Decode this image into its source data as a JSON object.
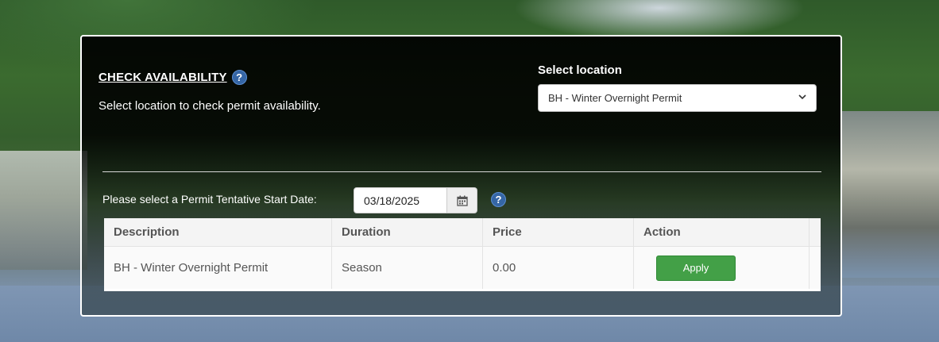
{
  "availability": {
    "title": "CHECK AVAILABILITY",
    "help_icon": "question-circle-icon",
    "subtitle": "Select location to check permit availability."
  },
  "location": {
    "label": "Select location",
    "selected": "BH - Winter Overnight Permit"
  },
  "date": {
    "label": "Please select a Permit Tentative Start Date:",
    "value": "03/18/2025",
    "calendar_icon": "calendar-icon"
  },
  "table": {
    "headers": [
      "Description",
      "Duration",
      "Price",
      "Action"
    ],
    "rows": [
      {
        "description": "BH - Winter Overnight Permit",
        "duration": "Season",
        "price": "0.00",
        "action_label": "Apply"
      }
    ]
  },
  "colors": {
    "help_icon": "#3566a6",
    "apply_button": "#43a047"
  }
}
